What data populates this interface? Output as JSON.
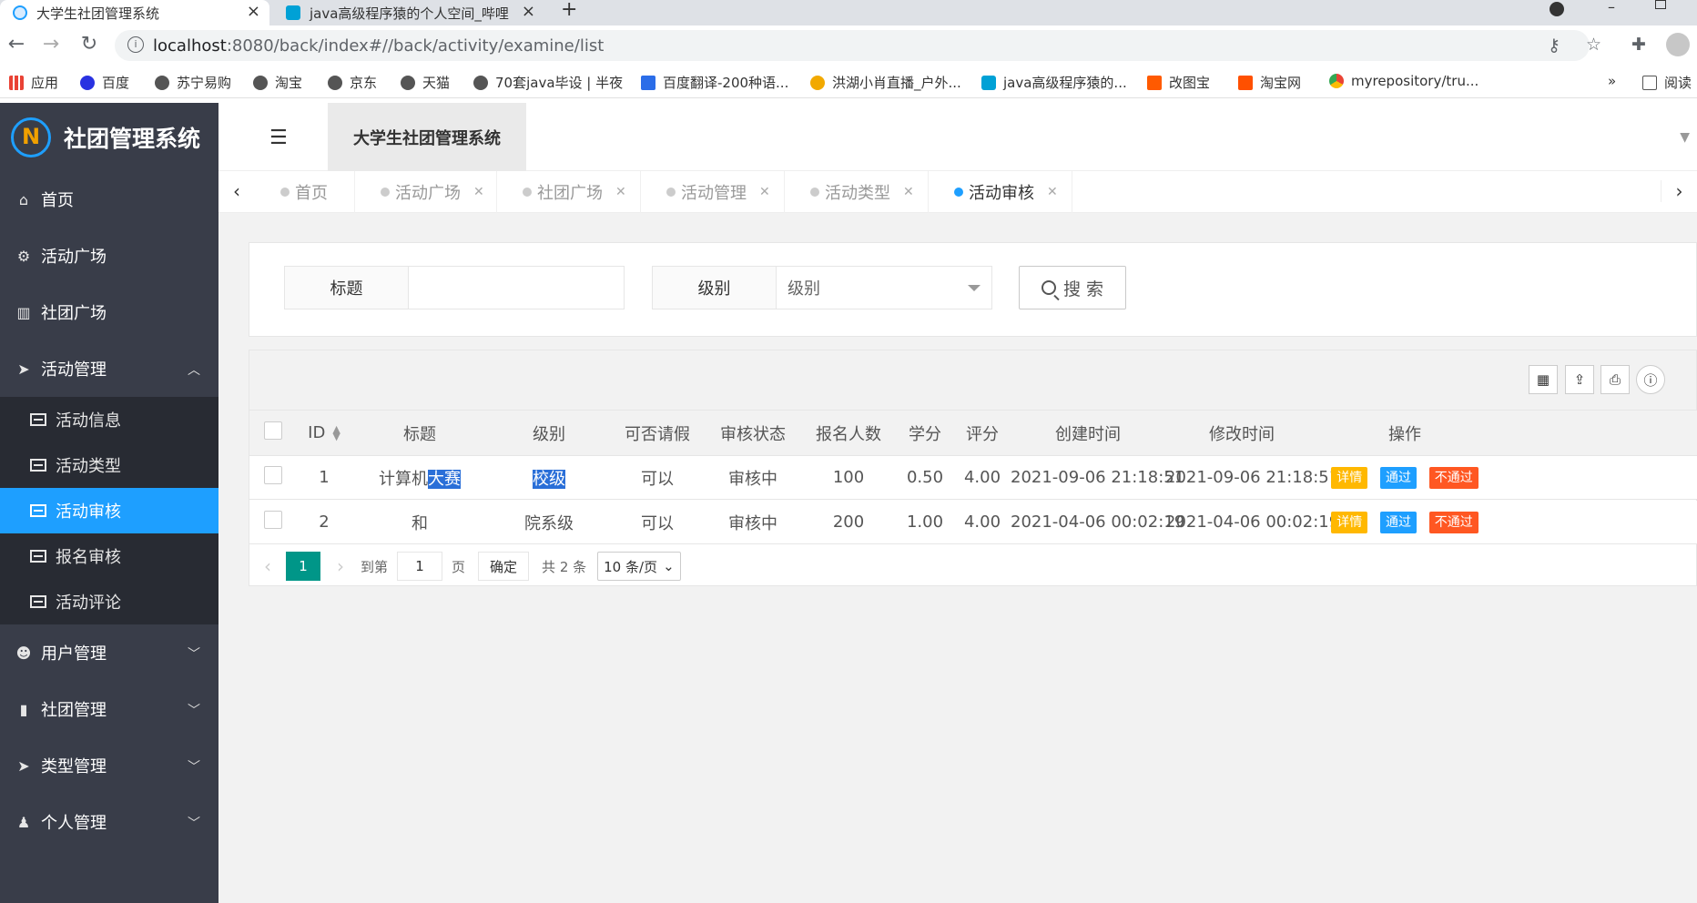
{
  "browser": {
    "tabs": [
      {
        "title": "大学生社团管理系统",
        "close": "×"
      },
      {
        "title": "java高级程序猿的个人空间_哔哩",
        "close": "×"
      }
    ],
    "new_tab": "+",
    "url_host": "localhost",
    "url_path": ":8080/back/index#//back/activity/examine/list",
    "info_icon": "i",
    "bookmarks": [
      {
        "label": "应用",
        "color": "#e94235"
      },
      {
        "label": "百度",
        "color": "#2932e1"
      },
      {
        "label": "苏宁易购",
        "color": "#555555"
      },
      {
        "label": "淘宝",
        "color": "#555555"
      },
      {
        "label": "京东",
        "color": "#555555"
      },
      {
        "label": "天猫",
        "color": "#555555"
      },
      {
        "label": "70套java毕设 | 半夜",
        "color": "#555555"
      },
      {
        "label": "百度翻译-200种语...",
        "color": "#2b6de8"
      },
      {
        "label": "洪湖小肖直播_户外...",
        "color": "#f2a900"
      },
      {
        "label": "java高级程序猿的...",
        "color": "#00a1d6"
      },
      {
        "label": "改图宝",
        "color": "#ff5a00"
      },
      {
        "label": "淘宝网",
        "color": "#ff5000"
      },
      {
        "label": "myrepository/tru...",
        "color": "#34a853"
      }
    ],
    "bookmarks_more": "»",
    "reading_list": "阅读"
  },
  "app": {
    "logo_text": "社团管理系统",
    "header_title": "大学生社团管理系统"
  },
  "sidebar": {
    "items": [
      {
        "label": "首页",
        "icon": "home-icon",
        "glyph": "⌂"
      },
      {
        "label": "活动广场",
        "icon": "motorcycle-icon",
        "glyph": "⚙"
      },
      {
        "label": "社团广场",
        "icon": "bank-icon",
        "glyph": "▥"
      },
      {
        "label": "活动管理",
        "icon": "paper-plane-icon",
        "glyph": "➤",
        "chevron": "︿"
      }
    ],
    "submenu": [
      "活动信息",
      "活动类型",
      "活动审核",
      "报名审核",
      "活动评论"
    ],
    "active_sub": "活动审核",
    "more": [
      {
        "label": "用户管理",
        "icon": "users-icon",
        "glyph": "☻",
        "chevron": "﹀"
      },
      {
        "label": "社团管理",
        "icon": "book-icon",
        "glyph": "▮",
        "chevron": "﹀"
      },
      {
        "label": "类型管理",
        "icon": "paper-plane-icon",
        "glyph": "➤",
        "chevron": "﹀"
      },
      {
        "label": "个人管理",
        "icon": "user-icon",
        "glyph": "♟",
        "chevron": "﹀"
      }
    ]
  },
  "page_tabs": [
    {
      "label": "首页",
      "closable": false
    },
    {
      "label": "活动广场",
      "closable": true
    },
    {
      "label": "社团广场",
      "closable": true
    },
    {
      "label": "活动管理",
      "closable": true
    },
    {
      "label": "活动类型",
      "closable": true
    },
    {
      "label": "活动审核",
      "closable": true,
      "active": true
    }
  ],
  "filter": {
    "title_label": "标题",
    "title_value": "",
    "level_label": "级别",
    "level_placeholder": "级别",
    "search_label": "搜 索"
  },
  "table": {
    "headers": [
      "ID",
      "标题",
      "级别",
      "可否请假",
      "审核状态",
      "报名人数",
      "学分",
      "评分",
      "创建时间",
      "修改时间",
      "操作"
    ],
    "rows": [
      {
        "id": "1",
        "title_a": "计算机",
        "title_b": "大赛",
        "level": "校级",
        "leave": "可以",
        "status": "审核中",
        "count": "100",
        "credit": "0.50",
        "score": "4.00",
        "created": "2021-09-06 21:18:51",
        "updated": "2021-09-06 21:18:51"
      },
      {
        "id": "2",
        "title_a": "和",
        "title_b": "",
        "level": "院系级",
        "leave": "可以",
        "status": "审核中",
        "count": "200",
        "credit": "1.00",
        "score": "4.00",
        "created": "2021-04-06 00:02:19",
        "updated": "2021-04-06 00:02:19"
      }
    ],
    "actions": {
      "detail": "详情",
      "pass": "通过",
      "reject": "不通过"
    }
  },
  "pager": {
    "current": "1",
    "goto_label": "到第",
    "goto_value": "1",
    "page_unit": "页",
    "confirm": "确定",
    "total": "共 2 条",
    "page_size": "10 条/页"
  }
}
